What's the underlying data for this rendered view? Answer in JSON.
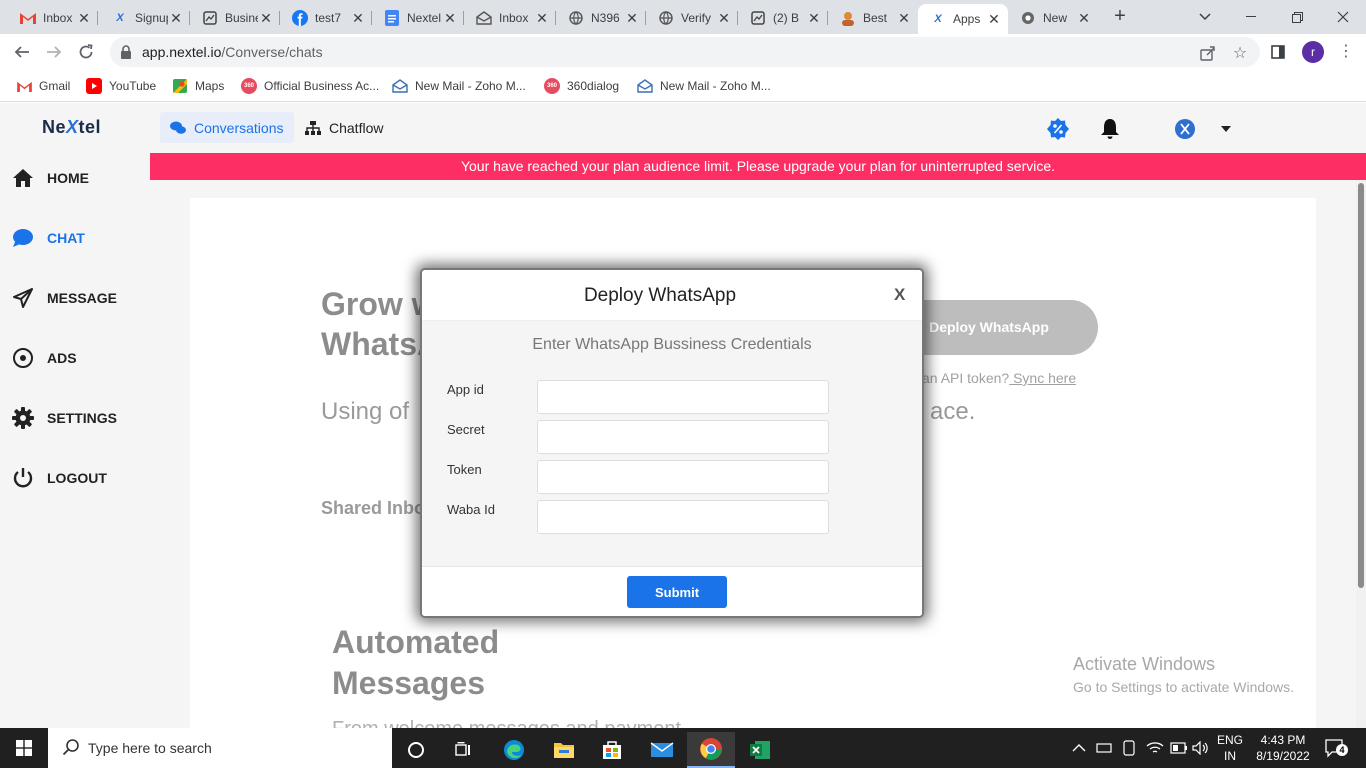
{
  "browser": {
    "tabs": [
      {
        "title": "Inbox",
        "icon": "gmail-icon"
      },
      {
        "title": "Signup",
        "icon": "nextel-icon"
      },
      {
        "title": "Business",
        "icon": "doc-image-icon"
      },
      {
        "title": "test7",
        "icon": "facebook-icon"
      },
      {
        "title": "Nextel",
        "icon": "google-docs-icon"
      },
      {
        "title": "Inbox",
        "icon": "zoho-mail-icon"
      },
      {
        "title": "N396",
        "icon": "globe-icon"
      },
      {
        "title": "Verify",
        "icon": "globe-icon"
      },
      {
        "title": "(2) B",
        "icon": "doc-image-icon"
      },
      {
        "title": "Best",
        "icon": "avatar-icon"
      },
      {
        "title": "Apps",
        "icon": "nextel-icon"
      },
      {
        "title": "New",
        "icon": "chrome-icon"
      }
    ],
    "new_tab": "+",
    "url_host": "app.nextel.io",
    "url_path": "/Converse/chats",
    "profile_letter": "r",
    "bookmarks": [
      {
        "label": "Gmail"
      },
      {
        "label": "YouTube"
      },
      {
        "label": "Maps"
      },
      {
        "label": "Official Business Ac..."
      },
      {
        "label": "New Mail - Zoho M..."
      },
      {
        "label": "360dialog"
      },
      {
        "label": "New Mail - Zoho M..."
      }
    ]
  },
  "app": {
    "logo_left": "Ne",
    "logo_mid": "X",
    "logo_right": "tel",
    "sidebar": [
      {
        "label": "HOME",
        "icon": "home-icon",
        "active": false
      },
      {
        "label": "CHAT",
        "icon": "chat-icon",
        "active": true
      },
      {
        "label": "MESSAGE",
        "icon": "send-icon",
        "active": false
      },
      {
        "label": "ADS",
        "icon": "ads-icon",
        "active": false
      },
      {
        "label": "SETTINGS",
        "icon": "gear-icon",
        "active": false
      },
      {
        "label": "LOGOUT",
        "icon": "power-icon",
        "active": false
      }
    ],
    "nav_tabs": [
      {
        "label": "Conversations",
        "icon": "comments-icon",
        "active": true
      },
      {
        "label": "Chatflow",
        "icon": "sitemap-icon",
        "active": false
      }
    ],
    "banner": "Your have reached your plan audience limit. Please upgrade your plan for uninterrupted service.",
    "background": {
      "grow_line1": "Grow with",
      "grow_line2": "WhatsApp",
      "grow_sub_left": "Using of",
      "grow_sub_right": "ace.",
      "shared": "Shared Inbox",
      "deploy_button": "Deploy WhatsApp",
      "sync_prefix": "an API token?",
      "sync_link": " Sync here",
      "auto_line1": "Automated",
      "auto_line2": "Messages",
      "auto_sub": "From welcome messages and payment"
    },
    "watermark": {
      "line1": "Activate Windows",
      "line2": "Go to Settings to activate Windows."
    }
  },
  "modal": {
    "title": "Deploy WhatsApp",
    "close": "X",
    "subtitle": "Enter WhatsApp Bussiness Credentials",
    "fields": [
      {
        "label": "App id",
        "value": ""
      },
      {
        "label": "Secret",
        "value": ""
      },
      {
        "label": "Token",
        "value": ""
      },
      {
        "label": "Waba Id",
        "value": ""
      }
    ],
    "submit": "Submit"
  },
  "taskbar": {
    "search_placeholder": "Type here to search",
    "lang_line1": "ENG",
    "lang_line2": "IN",
    "time": "4:43 PM",
    "date": "8/19/2022",
    "notifications": "4"
  },
  "colors": {
    "accent": "#1a73e8",
    "banner": "#fd2e64",
    "submit": "#1a73e8"
  }
}
